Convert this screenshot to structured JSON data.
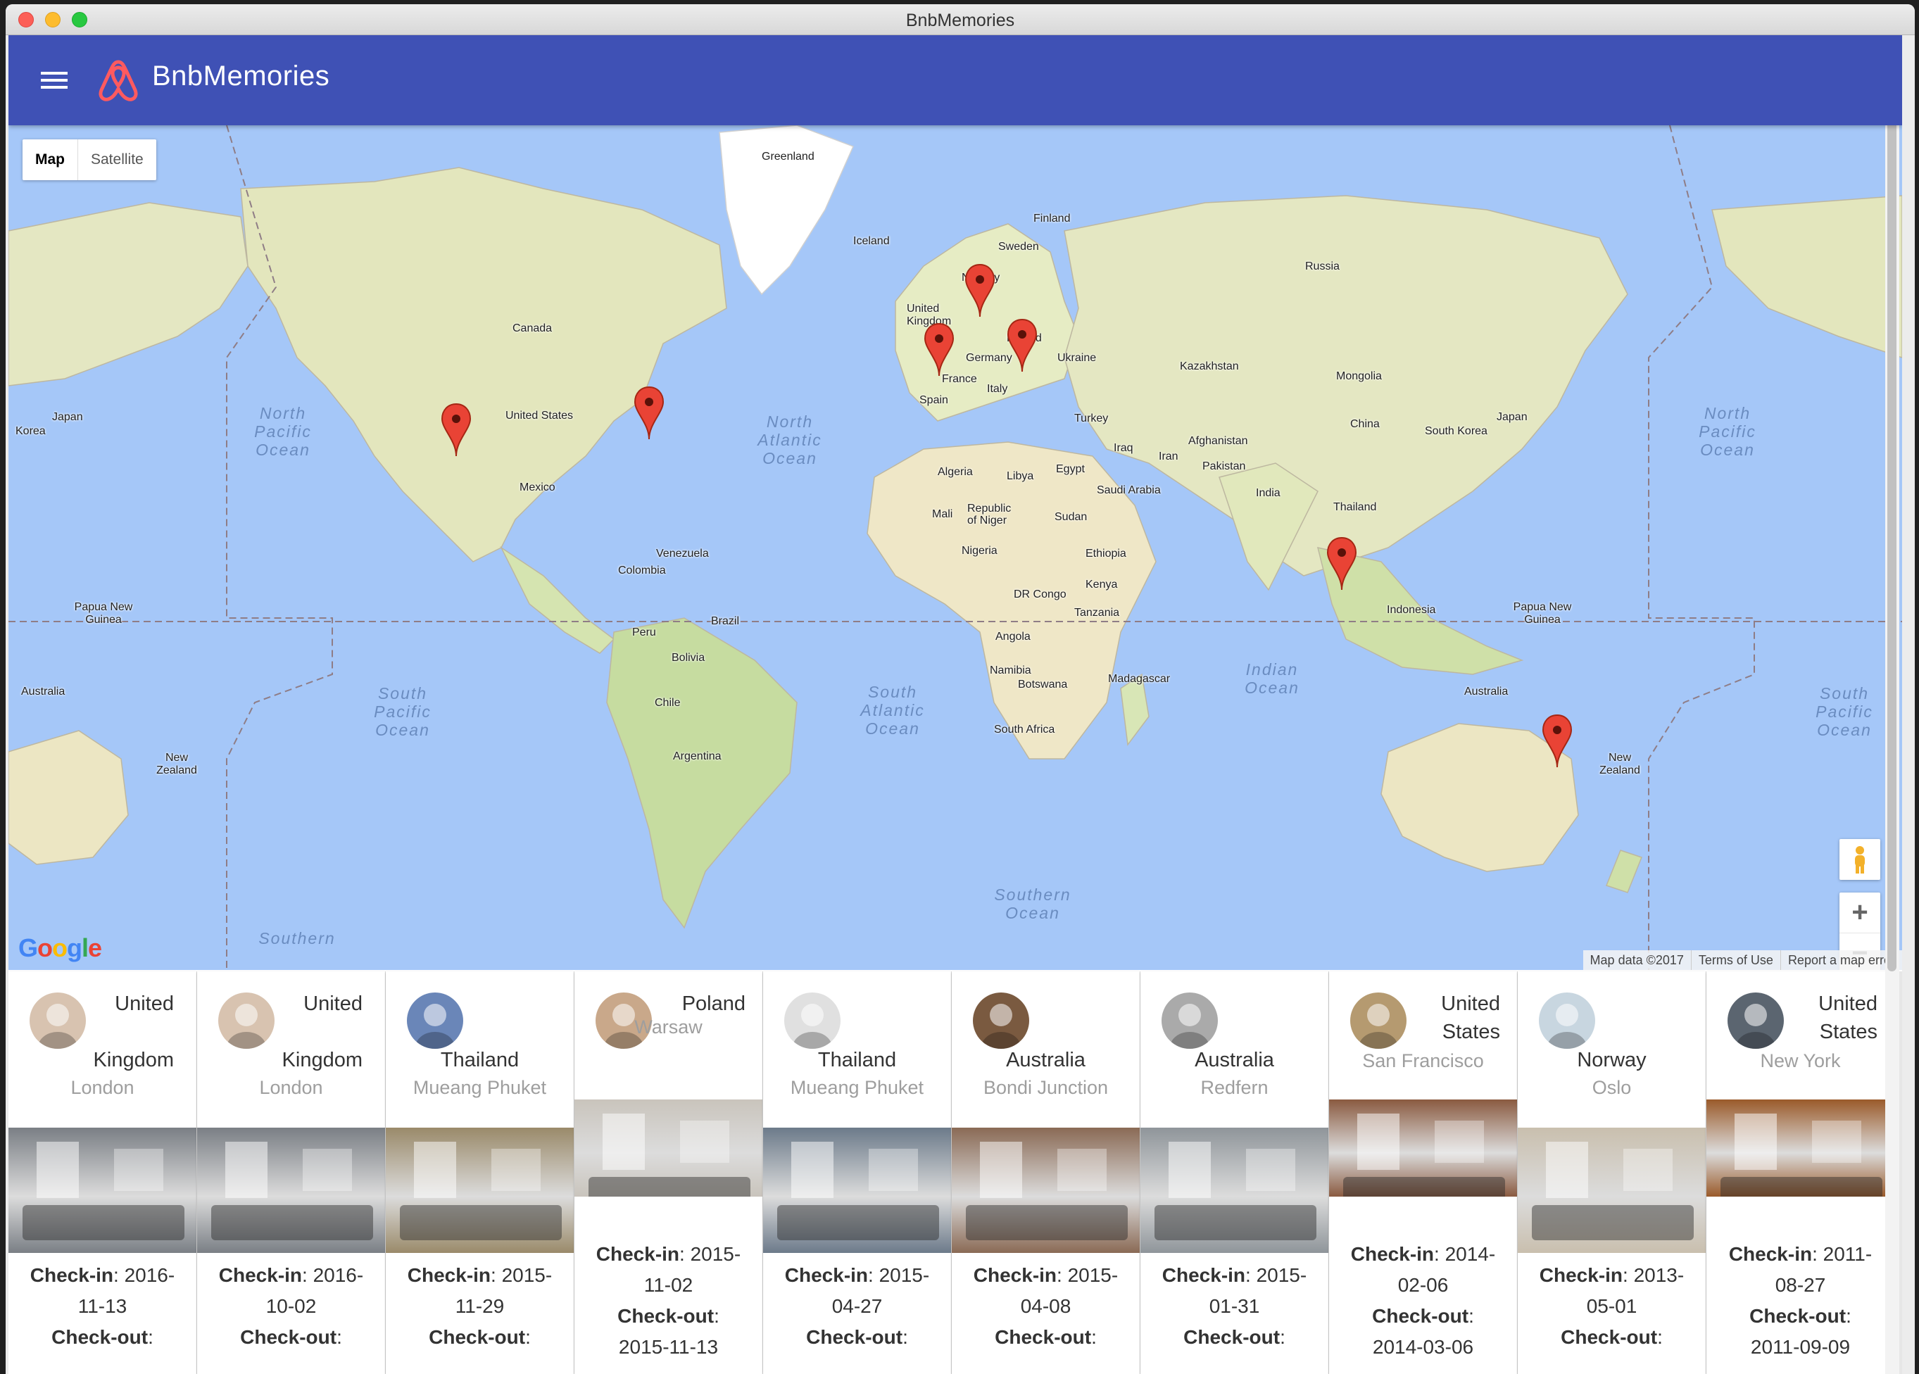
{
  "window": {
    "title": "BnbMemories"
  },
  "appbar": {
    "title": "BnbMemories"
  },
  "map": {
    "type_controls": {
      "map": "Map",
      "satellite": "Satellite"
    },
    "labels": {
      "greenland": "Greenland",
      "iceland": "Iceland",
      "finland": "Finland",
      "sweden": "Sweden",
      "norway": "Norway",
      "russia": "Russia",
      "united_kingdom": "United Kingdom",
      "poland": "Poland",
      "germany": "Germany",
      "ukraine": "Ukraine",
      "france": "France",
      "italy": "Italy",
      "spain": "Spain",
      "kazakhstan": "Kazakhstan",
      "mongolia": "Mongolia",
      "canada": "Canada",
      "united_states": "United States",
      "mexico": "Mexico",
      "japan_left": "Japan",
      "korea_left": "Korea",
      "japan_right": "Japan",
      "south_korea": "South Korea",
      "china": "China",
      "turkey": "Turkey",
      "iraq": "Iraq",
      "iran": "Iran",
      "afghanistan": "Afghanistan",
      "pakistan": "Pakistan",
      "india": "India",
      "thailand": "Thailand",
      "algeria": "Algeria",
      "libya": "Libya",
      "egypt": "Egypt",
      "saudi_arabia": "Saudi Arabia",
      "mali": "Mali",
      "niger": "Republic of Niger",
      "sudan": "Sudan",
      "nigeria": "Nigeria",
      "ethiopia": "Ethiopia",
      "dr_congo": "DR Congo",
      "kenya": "Kenya",
      "tanzania": "Tanzania",
      "angola": "Angola",
      "namibia": "Namibia",
      "botswana": "Botswana",
      "madagascar": "Madagascar",
      "south_africa": "South Africa",
      "venezuela": "Venezuela",
      "colombia": "Colombia",
      "peru": "Peru",
      "brazil": "Brazil",
      "bolivia": "Bolivia",
      "chile": "Chile",
      "argentina": "Argentina",
      "indonesia": "Indonesia",
      "png_left": "Papua New Guinea",
      "png_right": "Papua New Guinea",
      "australia_left": "Australia",
      "australia_right": "Australia",
      "nz_left": "New Zealand",
      "nz_right": "New Zealand"
    },
    "oceans": {
      "north_pacific_left": "North Pacific Ocean",
      "north_pacific_right": "North Pacific Ocean",
      "north_atlantic": "North Atlantic Ocean",
      "south_pacific_left": "South Pacific Ocean",
      "south_pacific_right": "South Pacific Ocean",
      "south_atlantic": "South Atlantic Ocean",
      "indian": "Indian Ocean",
      "southern": "Southern Ocean",
      "southern_left": "Southern"
    },
    "zoom_in": "+",
    "zoom_out": "−",
    "google_logo": "Google",
    "attribution": {
      "data": "Map data ©2017",
      "terms": "Terms of Use",
      "report": "Report a map error"
    }
  },
  "cards": [
    {
      "country": "United Kingdom",
      "city": "London",
      "checkin_label": "Check-in",
      "checkin": ": 2016-11-13",
      "checkout_label": "Check-out",
      "checkout": ":",
      "photo_color": "#7a7f85"
    },
    {
      "country": "United Kingdom",
      "city": "London",
      "checkin_label": "Check-in",
      "checkin": ": 2016-10-02",
      "checkout_label": "Check-out",
      "checkout": ":",
      "photo_color": "#7a7f85"
    },
    {
      "country": "Thailand",
      "city": "Mueang Phuket",
      "checkin_label": "Check-in",
      "checkin": ": 2015-11-29",
      "checkout_label": "Check-out",
      "checkout": ":",
      "photo_color": "#9a8a6a"
    },
    {
      "country": "Poland",
      "city": "Warsaw",
      "checkin_label": "Check-in",
      "checkin": ": 2015-11-02",
      "checkout_label": "Check-out",
      "checkout": ":",
      "checkout_date": "2015-11-13",
      "photo_color": "#c9c4bc"
    },
    {
      "country": "Thailand",
      "city": "Mueang Phuket",
      "checkin_label": "Check-in",
      "checkin": ": 2015-04-27",
      "checkout_label": "Check-out",
      "checkout": ":",
      "photo_color": "#6c7a8a"
    },
    {
      "country": "Australia",
      "city": "Bondi Junction",
      "checkin_label": "Check-in",
      "checkin": ": 2015-04-08",
      "checkout_label": "Check-out",
      "checkout": ":",
      "photo_color": "#8a6a55"
    },
    {
      "country": "Australia",
      "city": "Redfern",
      "checkin_label": "Check-in",
      "checkin": ": 2015-01-31",
      "checkout_label": "Check-out",
      "checkout": ":",
      "photo_color": "#8f959a"
    },
    {
      "country": "United States",
      "city": "San Francisco",
      "checkin_label": "Check-in",
      "checkin": ": 2014-02-06",
      "checkout_label": "Check-out",
      "checkout": ":",
      "checkout_date": "2014-03-06",
      "photo_color": "#8a5a40"
    },
    {
      "country": "Norway",
      "city": "Oslo",
      "checkin_label": "Check-in",
      "checkin": ": 2013-05-01",
      "checkout_label": "Check-out",
      "checkout": ":",
      "photo_color": "#c9bfae"
    },
    {
      "country": "United States",
      "city": "New York",
      "checkin_label": "Check-in",
      "checkin": ": 2011-08-27",
      "checkout_label": "Check-out",
      "checkout": ":",
      "checkout_date": "2011-09-09",
      "photo_color": "#9a5a2a"
    }
  ]
}
